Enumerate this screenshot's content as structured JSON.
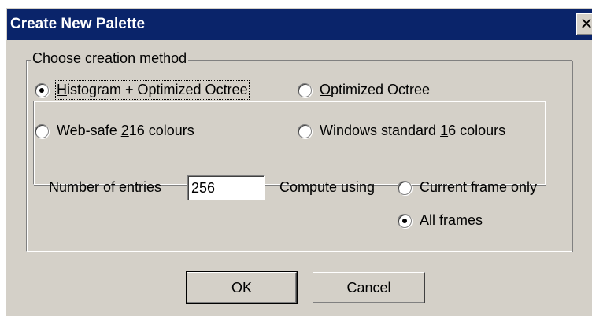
{
  "dialog": {
    "title": "Create New Palette",
    "close_glyph": "✕"
  },
  "creation_group": {
    "legend": "Choose creation method",
    "options": [
      {
        "pre": "",
        "u": "H",
        "post": "istogram + Optimized Octree",
        "selected": true,
        "focused": true
      },
      {
        "pre": "",
        "u": "O",
        "post": "ptimized Octree",
        "selected": false
      },
      {
        "pre": "Web-safe ",
        "u": "2",
        "post": "16 colours",
        "selected": false
      },
      {
        "pre": "Windows standard ",
        "u": "1",
        "post": "6 colours",
        "selected": false
      }
    ]
  },
  "entries": {
    "label_pre": "",
    "label_u": "N",
    "label_post": "umber of entries",
    "value": "256"
  },
  "compute": {
    "label": "Compute using",
    "options": [
      {
        "pre": "",
        "u": "C",
        "post": "urrent frame only",
        "selected": false
      },
      {
        "pre": "",
        "u": "A",
        "post": "ll frames",
        "selected": true
      }
    ]
  },
  "buttons": {
    "ok": "OK",
    "cancel": "Cancel"
  }
}
